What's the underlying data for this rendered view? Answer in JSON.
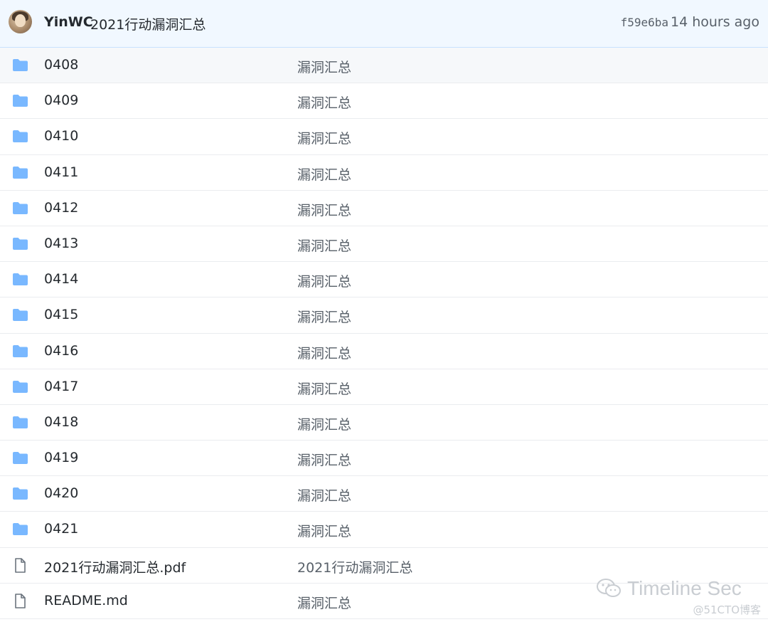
{
  "commit": {
    "author": "YinWC",
    "message": "2021行动漏洞汇总",
    "sha": "f59e6ba",
    "age": "14 hours ago"
  },
  "files": [
    {
      "type": "folder",
      "name": "0408",
      "message": "漏洞汇总"
    },
    {
      "type": "folder",
      "name": "0409",
      "message": "漏洞汇总"
    },
    {
      "type": "folder",
      "name": "0410",
      "message": "漏洞汇总"
    },
    {
      "type": "folder",
      "name": "0411",
      "message": "漏洞汇总"
    },
    {
      "type": "folder",
      "name": "0412",
      "message": "漏洞汇总"
    },
    {
      "type": "folder",
      "name": "0413",
      "message": "漏洞汇总"
    },
    {
      "type": "folder",
      "name": "0414",
      "message": "漏洞汇总"
    },
    {
      "type": "folder",
      "name": "0415",
      "message": "漏洞汇总"
    },
    {
      "type": "folder",
      "name": "0416",
      "message": "漏洞汇总"
    },
    {
      "type": "folder",
      "name": "0417",
      "message": "漏洞汇总"
    },
    {
      "type": "folder",
      "name": "0418",
      "message": "漏洞汇总"
    },
    {
      "type": "folder",
      "name": "0419",
      "message": "漏洞汇总"
    },
    {
      "type": "folder",
      "name": "0420",
      "message": "漏洞汇总"
    },
    {
      "type": "folder",
      "name": "0421",
      "message": "漏洞汇总"
    },
    {
      "type": "file",
      "name": "2021行动漏洞汇总.pdf",
      "message": "2021行动漏洞汇总"
    },
    {
      "type": "file",
      "name": "README.md",
      "message": "漏洞汇总"
    }
  ],
  "watermark": {
    "brand": "Timeline Sec",
    "site": "@51CTO博客"
  },
  "colors": {
    "folder_icon": "#79b8ff",
    "file_icon": "#6a737d",
    "header_bg": "#f1f8ff",
    "row_hover_bg": "#f6f8fa",
    "row_border": "#eaecef"
  },
  "icons": {
    "folder": "folder-icon",
    "file": "file-icon",
    "wechat": "wechat-icon"
  }
}
